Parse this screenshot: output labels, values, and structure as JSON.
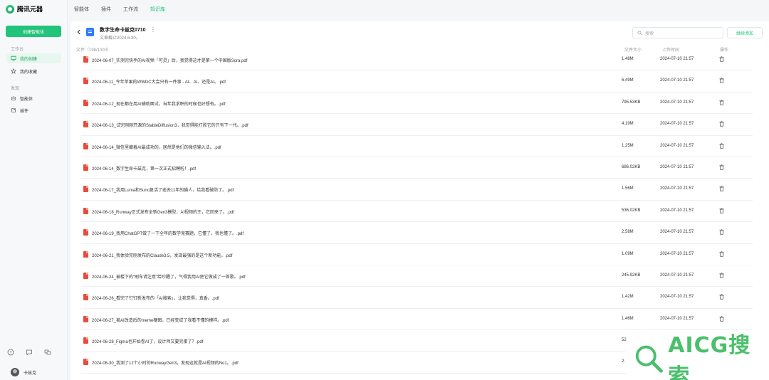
{
  "app": {
    "name": "腾讯元器"
  },
  "sidebar": {
    "create_label": "创建智能体",
    "section_workspace": "工作台",
    "section_discover": "发现",
    "items": [
      {
        "label": "我的创建",
        "icon": "monitor-icon"
      },
      {
        "label": "我的收藏",
        "icon": "star-icon"
      },
      {
        "label": "智能体",
        "icon": "bot-icon"
      },
      {
        "label": "插件",
        "icon": "plugin-icon"
      }
    ],
    "user_name": "卡兹克"
  },
  "topnav": {
    "tabs": [
      "智能体",
      "插件",
      "工作流",
      "知识库"
    ],
    "active": "知识库"
  },
  "kb": {
    "title": "数字生命卡兹克0710",
    "subtitle": "文章截止2024.6.30。",
    "more": "⋮",
    "search_placeholder": "搜索",
    "add_label": "继续添加"
  },
  "table": {
    "headers": {
      "file": "文件（198/1000）",
      "size": "文件大小",
      "time": "上传时间",
      "action": "操作"
    },
    "rows": [
      {
        "name": "2024-06-07_实测完快手的AI视频「可灵」后，我觉得这才是第一个中国版Sora.pdf",
        "size": "1.48M",
        "time": "2024-07-10 21:57"
      },
      {
        "name": "2024-06-11_今年苹果的WWDC大会只有一件事 - AI、AI、还是AI。.pdf",
        "size": "6.49M",
        "time": "2024-07-10 21:57"
      },
      {
        "name": "2024-06-12_现在都在用AI辅助面试，当年我求职的时候也好想有。.pdf",
        "size": "795.53KB",
        "time": "2024-07-10 21:57"
      },
      {
        "name": "2024-06-13_试完刚刚开源的StableDiffusion3，我觉得能打败它的只有下一代。.pdf",
        "size": "4.19M",
        "time": "2024-07-10 21:57"
      },
      {
        "name": "2024-06-14_微信里藏着AI最成功的，居然是他们的微信输入法。.pdf",
        "size": "1.25M",
        "time": "2024-07-10 21:57"
      },
      {
        "name": "2024-06-14_数字生命卡兹克，第一次正式招聘啦！.pdf",
        "size": "686.02KB",
        "time": "2024-07-10 21:57"
      },
      {
        "name": "2024-06-17_我用Luma和Suno复活了逝去11年的猫人，给我看破防了。.pdf",
        "size": "1.56M",
        "time": "2024-07-10 21:57"
      },
      {
        "name": "2024-06-18_Runway正式发布全新Gen3模型，AI视频的王，它回来了。.pdf",
        "size": "536.02KB",
        "time": "2024-07-10 21:57"
      },
      {
        "name": "2024-06-19_我用ChatGPT做了一下全年的数学竞赛题，它懂了，我也懂了。.pdf",
        "size": "2.58M",
        "time": "2024-07-10 21:57"
      },
      {
        "name": "2024-06-21_我体验完刚发布的Claude3.5，发现最强的是这个新功能。.pdf",
        "size": "1.09M",
        "time": "2024-07-10 21:57"
      },
      {
        "name": "2024-06-24_被楼下的“刷车请注意”给吵醒了，气得我用AI把它做成了一首歌。.pdf",
        "size": "245.92KB",
        "time": "2024-07-10 21:57"
      },
      {
        "name": "2024-06-26_看完了钉钉新发布的「AI搜索」，让我觉得，真香。.pdf",
        "size": "1.42M",
        "time": "2024-07-10 21:57"
      },
      {
        "name": "2024-06-27_被AI改造后的meme梗图，已经变成了我看不懂的模样。.pdf",
        "size": "1.46M",
        "time": "2024-07-10 21:57"
      },
      {
        "name": "2024-06-28_Figma也开始卷AI了，设计师又要完蛋了？.pdf",
        "size": "52",
        "time": ""
      },
      {
        "name": "2024-06-30_我测了12个小时的RunwayGen3，发现这就是AI视频的No1。.pdf",
        "size": "2.",
        "time": ""
      }
    ]
  },
  "watermark": {
    "text": "AICG搜索",
    "color": "#4bbf6b"
  }
}
